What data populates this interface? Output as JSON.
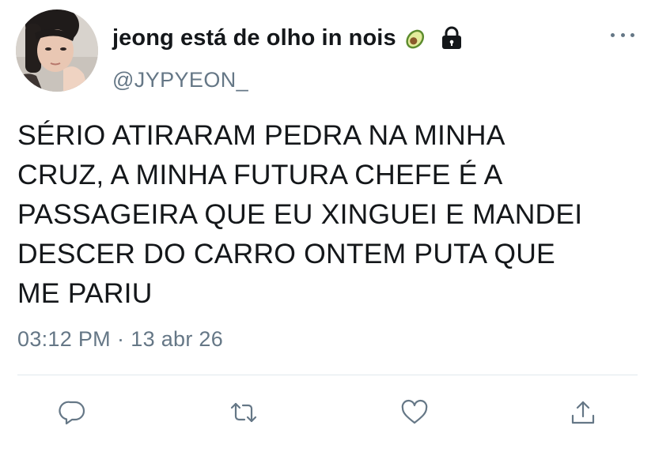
{
  "user": {
    "display_name": "jeong está de olho in nois",
    "handle": "@JYPYEON_",
    "name_emoji": "avocado-icon",
    "protected_icon": "lock-icon"
  },
  "tweet": {
    "text": "SÉRIO ATIRARAM PEDRA NA MINHA\nCRUZ, A MINHA FUTURA CHEFE É A\nPASSAGEIRA QUE EU XINGUEI E MANDEI\nDESCER DO CARRO ONTEM PUTA QUE\nME PARIU",
    "time": "03:12 PM",
    "separator": "·",
    "date": "13 abr 26"
  },
  "actions": {
    "reply": "reply-icon",
    "retweet": "retweet-icon",
    "like": "heart-icon",
    "share": "share-icon"
  },
  "colors": {
    "primary_text": "#14171a",
    "secondary_text": "#657786",
    "divider": "#e1e8ed",
    "background": "#ffffff"
  }
}
